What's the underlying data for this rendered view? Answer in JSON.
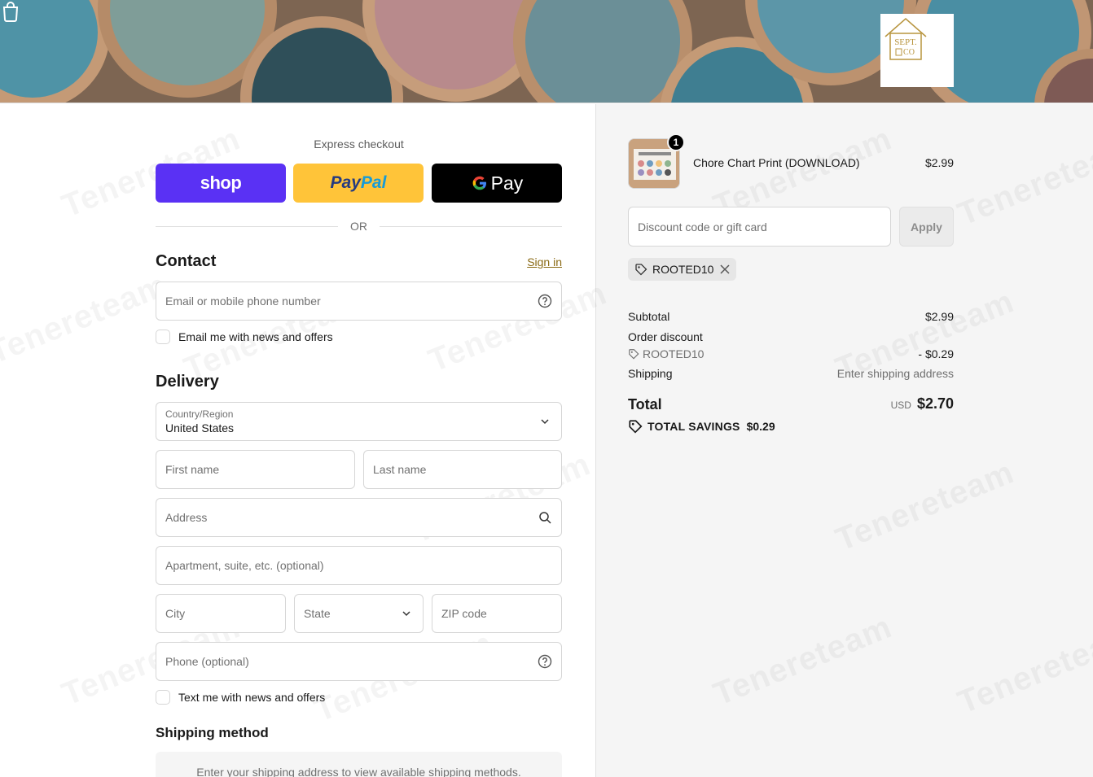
{
  "header": {
    "cart_icon": "shopping-bag-icon",
    "logo_line1": "SEPT.",
    "logo_line2": "CO"
  },
  "express": {
    "label": "Express checkout",
    "shop_label": "shop",
    "paypal_part1": "Pay",
    "paypal_part2": "Pal",
    "gpay_label": "Pay",
    "or_label": "OR"
  },
  "contact": {
    "title": "Contact",
    "signin_label": "Sign in",
    "email_placeholder": "Email or mobile phone number",
    "news_label": "Email me with news and offers"
  },
  "delivery": {
    "title": "Delivery",
    "country_label": "Country/Region",
    "country_value": "United States",
    "first_name": "First name",
    "last_name": "Last name",
    "address": "Address",
    "apartment": "Apartment, suite, etc. (optional)",
    "city": "City",
    "state": "State",
    "zip": "ZIP code",
    "phone": "Phone (optional)",
    "text_news_label": "Text me with news and offers"
  },
  "shipping_method": {
    "title": "Shipping method",
    "message": "Enter your shipping address to view available shipping methods."
  },
  "summary": {
    "product": {
      "name": "Chore Chart Print (DOWNLOAD)",
      "price": "$2.99",
      "quantity": "1"
    },
    "discount_placeholder": "Discount code or gift card",
    "apply_label": "Apply",
    "applied_code": "ROOTED10",
    "subtotal_label": "Subtotal",
    "subtotal_value": "$2.99",
    "order_discount_label": "Order discount",
    "discount_code": "ROOTED10",
    "discount_value": "- $0.29",
    "shipping_label": "Shipping",
    "shipping_value": "Enter shipping address",
    "total_label": "Total",
    "currency": "USD",
    "total_value": "$2.70",
    "savings_label": "TOTAL SAVINGS",
    "savings_value": "$0.29"
  },
  "colors": {
    "shop_purple": "#5a31f4",
    "paypal_yellow": "#ffc439",
    "link_gold": "#8a6a14"
  }
}
